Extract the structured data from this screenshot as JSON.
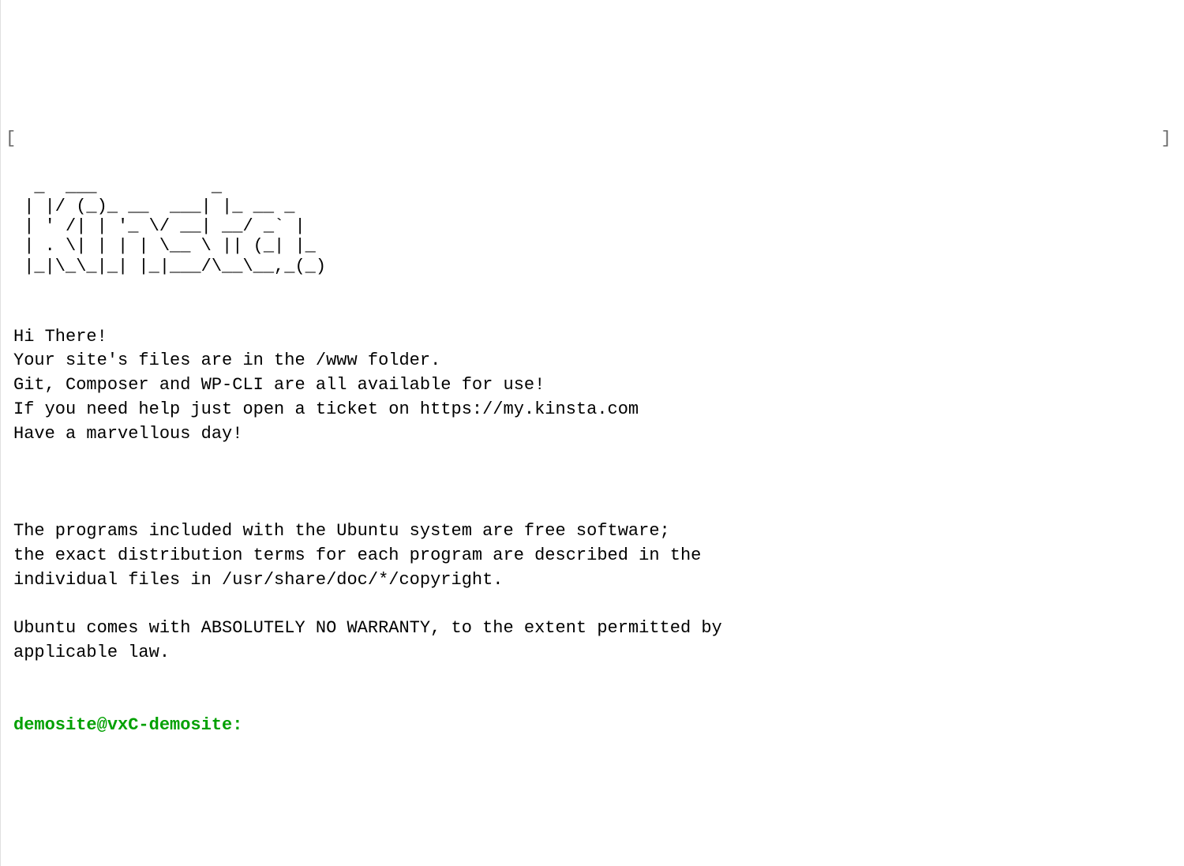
{
  "terminal": {
    "bracket_left": "[",
    "bracket_right": "]",
    "ascii_art": {
      "line1": "  _  ___           _",
      "line2": " | |/ (_)_ __  ___| |_ __ _",
      "line3": " | ' /| | '_ \\/ __| __/ _` |",
      "line4": " | . \\| | | | \\__ \\ || (_| |_",
      "line5": " |_|\\_\\_|_| |_|___/\\__\\__,_(_)"
    },
    "motd": {
      "line1": "Hi There!",
      "line2": "Your site's files are in the /www folder.",
      "line3": "Git, Composer and WP-CLI are all available for use!",
      "line4": "If you need help just open a ticket on https://my.kinsta.com",
      "line5": "Have a marvellous day!"
    },
    "ubuntu_notice": {
      "line1": "The programs included with the Ubuntu system are free software;",
      "line2": "the exact distribution terms for each program are described in the",
      "line3": "individual files in /usr/share/doc/*/copyright.",
      "line4": "Ubuntu comes with ABSOLUTELY NO WARRANTY, to the extent permitted by",
      "line5": "applicable law."
    },
    "prompt": {
      "user_host": "demosite@vxC-demosite",
      "separator": ":"
    }
  }
}
